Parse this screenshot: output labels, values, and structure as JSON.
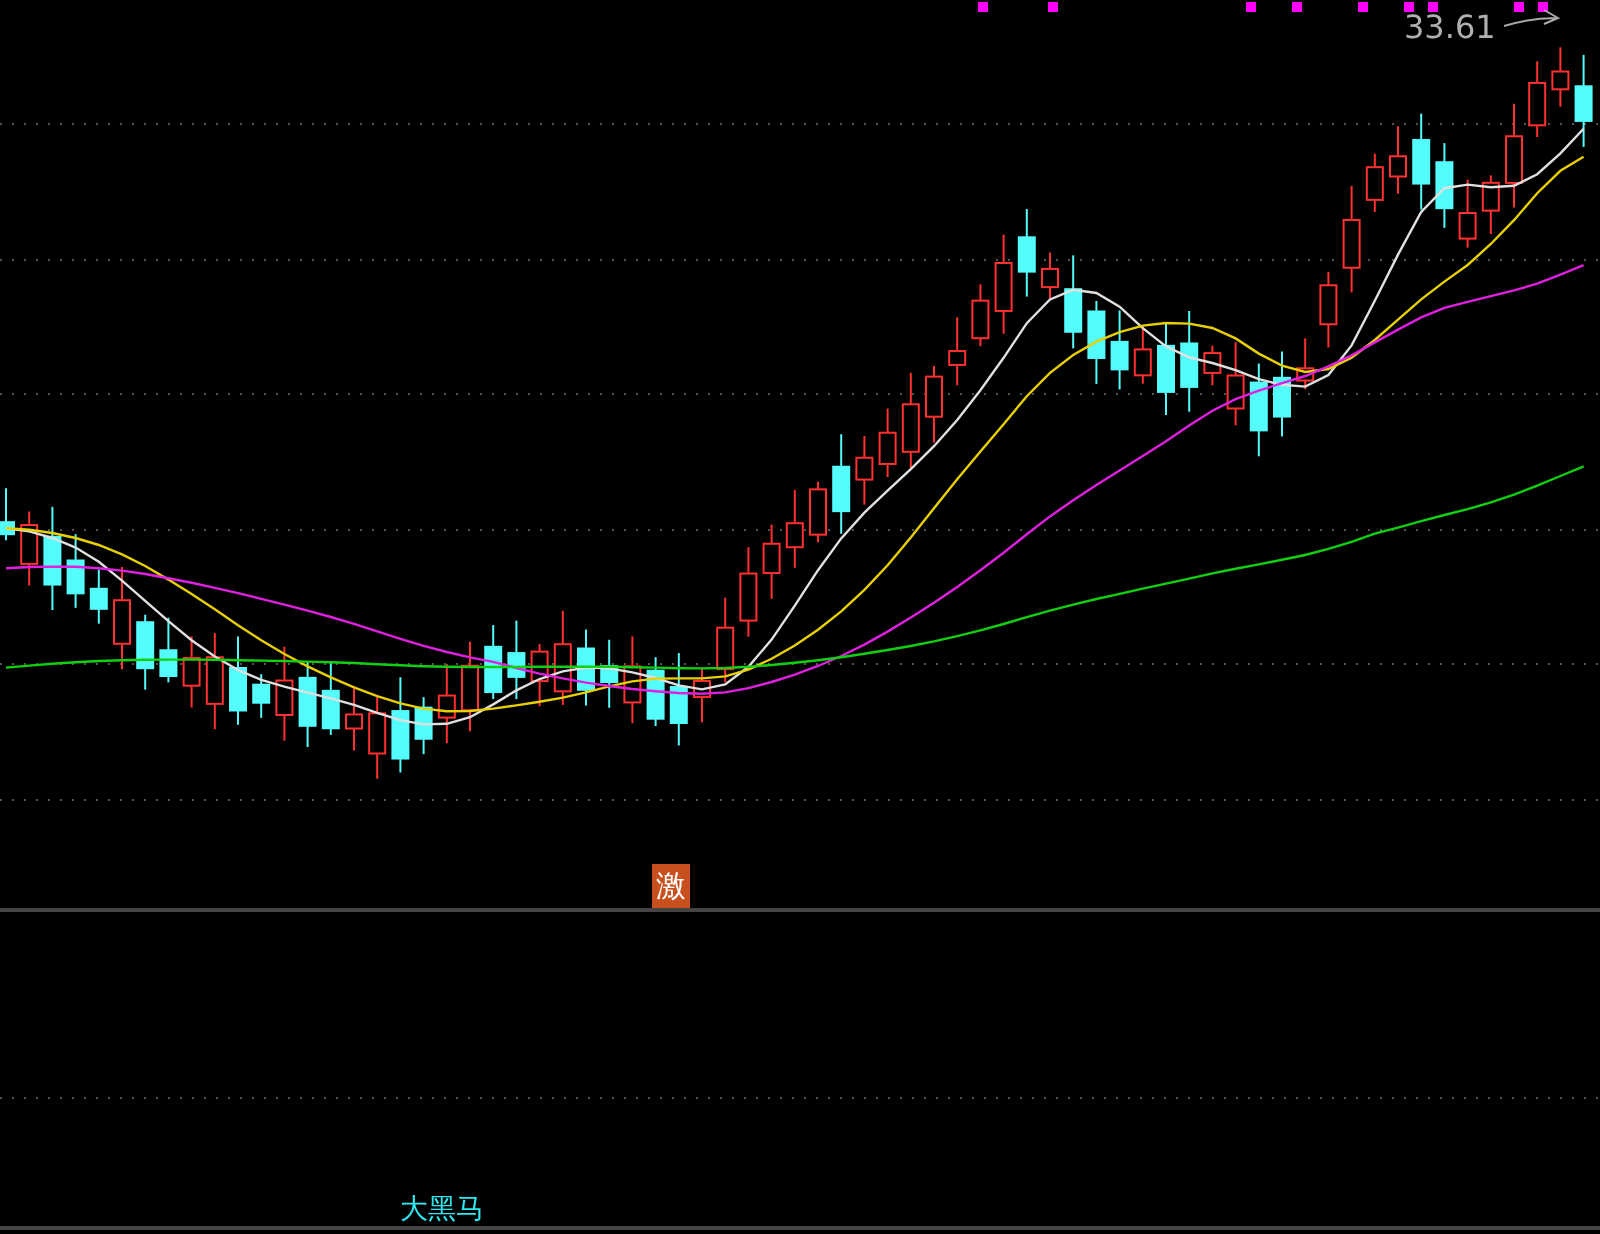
{
  "price_chart": {
    "high_label": "33.61",
    "signal_badge": "激"
  },
  "indicator_panel": {
    "label": "大黑马"
  }
}
